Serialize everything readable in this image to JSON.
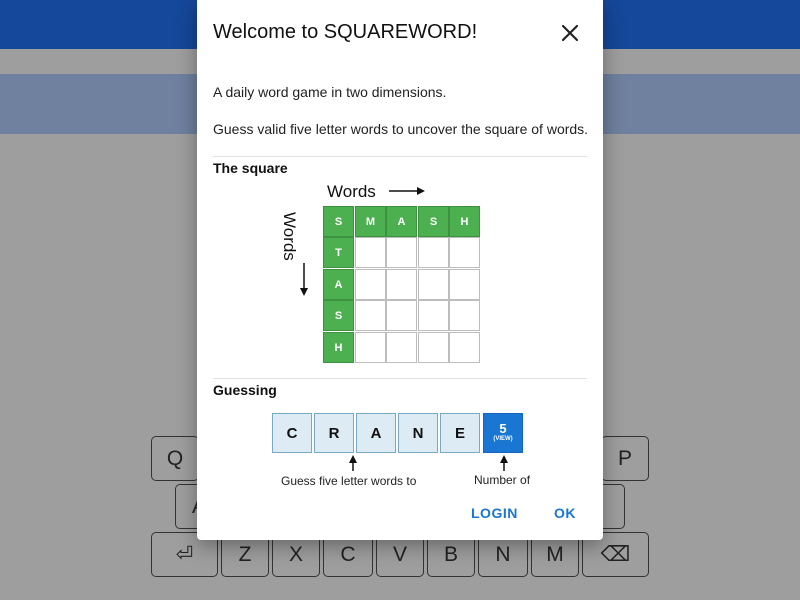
{
  "dialog": {
    "title": "Welcome to SQUAREWORD!",
    "intro": "A daily word game in two dimensions.",
    "intro2": "Guess valid five letter words to uncover the square of words.",
    "square_heading": "The square",
    "words_label_top": "Words",
    "words_label_side": "Words",
    "top_row": [
      "S",
      "M",
      "A",
      "S",
      "H"
    ],
    "side_col": [
      "T",
      "A",
      "S",
      "H"
    ],
    "guessing_heading": "Guessing",
    "guess_letters": [
      "C",
      "R",
      "A",
      "N",
      "E"
    ],
    "count_value": "5",
    "count_sub": "(VIEW)",
    "guess_caption": "Guess five letter words to",
    "count_caption": "Number of",
    "login_label": "LOGIN",
    "ok_label": "OK",
    "close_icon": "close-icon"
  },
  "keyboard": {
    "row1_visible": [
      "Q",
      "P"
    ],
    "row2_visible": [
      "A"
    ],
    "row3": [
      "⏎",
      "Z",
      "X",
      "C",
      "V",
      "B",
      "N",
      "M",
      "⌫"
    ]
  },
  "colors": {
    "header": "#15479a",
    "subheader": "#6f819f",
    "overlay_bg": "#9e9e9e",
    "green": "#4caf50",
    "blue_tile": "#1976d2",
    "guess_tile": "#dcebf4",
    "accent": "#1976d2"
  }
}
